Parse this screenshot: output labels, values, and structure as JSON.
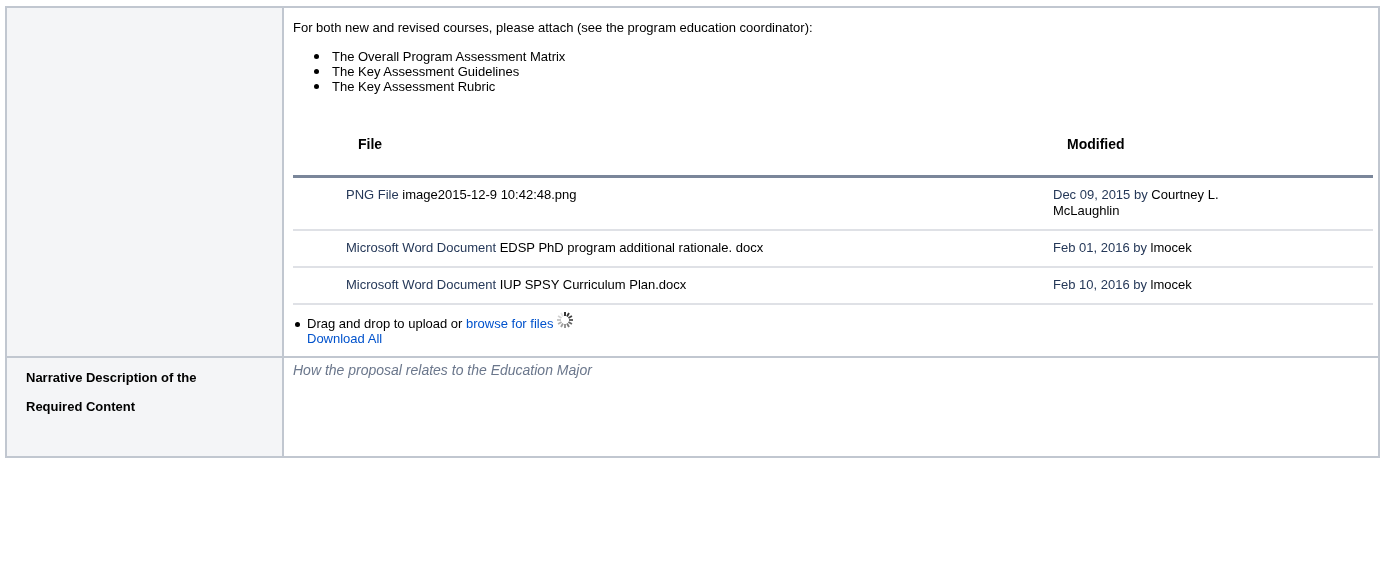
{
  "attachments_row": {
    "intro": "For both new and revised courses, please attach (see the program education coordinator):",
    "items": [
      "The Overall Program Assessment Matrix",
      "The Key Assessment Guidelines",
      "The Key Assessment Rubric"
    ],
    "files_table": {
      "columns": [
        "File",
        "Modified"
      ],
      "rows": [
        {
          "file_type": "PNG File",
          "name": "image2015-12-9 10:42:48.png",
          "modified": "Dec 09, 2015 by",
          "author": "Courtney L. McLaughlin"
        },
        {
          "file_type": "Microsoft Word Document",
          "name": "EDSP PhD program additional rationale. docx",
          "modified": "Feb 01, 2016 by",
          "author": "lmocek"
        },
        {
          "file_type": "Microsoft Word Document",
          "name": "IUP SPSY Curriculum Plan.docx",
          "modified": "Feb 10, 2016 by",
          "author": "lmocek"
        }
      ]
    },
    "upload": {
      "text": "Drag and drop to upload or",
      "link": "browse for files"
    },
    "download_all": "Download All"
  },
  "narrative_row": {
    "label_lines": [
      "Narrative Description of the",
      "Required Content"
    ],
    "placeholder": "How the proposal relates to the Education Major"
  }
}
